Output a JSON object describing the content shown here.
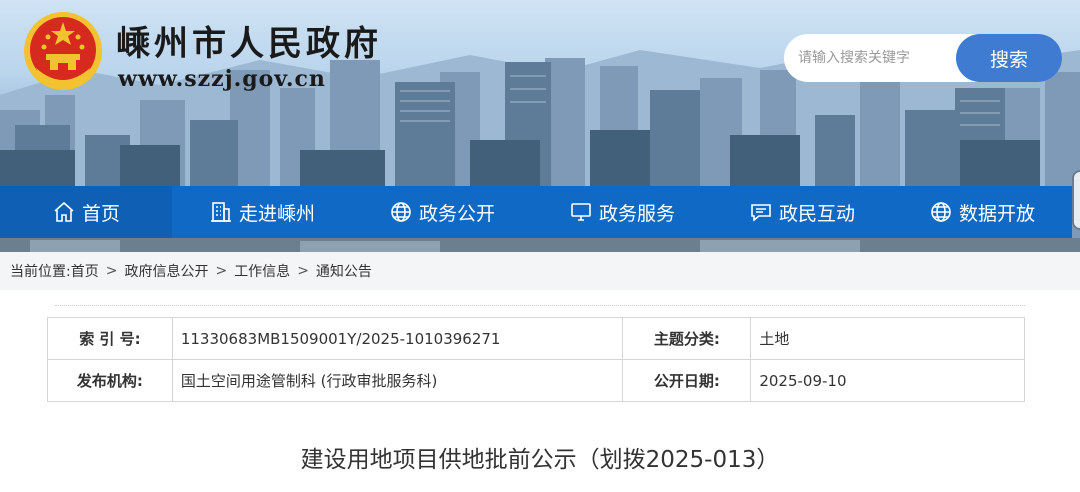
{
  "header": {
    "site_name": "嵊州市人民政府",
    "site_url": "www.szzj.gov.cn"
  },
  "search": {
    "placeholder": "请输入搜索关键字",
    "button_label": "搜索"
  },
  "nav": {
    "items": [
      {
        "label": "首页",
        "icon": "home-icon"
      },
      {
        "label": "走进嵊州",
        "icon": "building-icon"
      },
      {
        "label": "政务公开",
        "icon": "globe-icon"
      },
      {
        "label": "政务服务",
        "icon": "monitor-icon"
      },
      {
        "label": "政民互动",
        "icon": "chat-icon"
      },
      {
        "label": "数据开放",
        "icon": "globe-icon"
      }
    ]
  },
  "breadcrumb": {
    "prefix": "当前位置:",
    "items": [
      "首页",
      "政府信息公开",
      "工作信息",
      "通知公告"
    ],
    "separator": ">"
  },
  "meta": {
    "index_label": "索 引 号:",
    "index_value": "11330683MB1509001Y/2025-1010396271",
    "topic_label": "主题分类:",
    "topic_value": "土地",
    "publisher_label": "发布机构:",
    "publisher_value": "国土空间用途管制科 (行政审批服务科)",
    "date_label": "公开日期:",
    "date_value": "2025-09-10"
  },
  "document": {
    "title": "建设用地项目供地批前公示（划拨2025-013）"
  },
  "colors": {
    "nav_blue": "#1169c6",
    "search_blue": "#3f7bd0",
    "emblem_red": "#d62a1e",
    "emblem_gold": "#f2c230"
  }
}
